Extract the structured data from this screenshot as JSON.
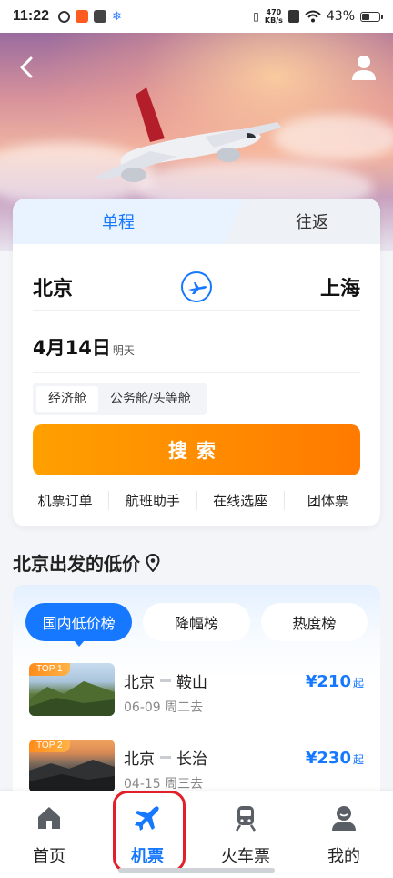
{
  "status_bar": {
    "time": "11:22",
    "net_speed_value": "470",
    "net_speed_unit": "KB/s",
    "battery": "43%"
  },
  "header": {
    "back_icon": "back-arrow-icon",
    "user_icon": "user-icon"
  },
  "trip_tabs": [
    {
      "label": "单程",
      "active": true
    },
    {
      "label": "往返",
      "active": false
    }
  ],
  "route": {
    "from": "北京",
    "to": "上海",
    "swap_icon": "plane-swap-icon"
  },
  "date": {
    "main": "4月14日",
    "sub": "明天"
  },
  "cabins": [
    {
      "label": "经济舱",
      "active": true
    },
    {
      "label": "公务舱/头等舱",
      "active": false
    }
  ],
  "search_button": "搜索",
  "quick_links": [
    "机票订单",
    "航班助手",
    "在线选座",
    "团体票"
  ],
  "low_price": {
    "title": "北京出发的低价",
    "tabs": [
      {
        "label": "国内低价榜",
        "active": true
      },
      {
        "label": "降幅榜",
        "active": false
      },
      {
        "label": "热度榜",
        "active": false
      }
    ],
    "routes": [
      {
        "rank": "TOP 1",
        "from": "北京",
        "to": "鞍山",
        "date": "06-09 周二去",
        "price": "¥210",
        "suffix": "起"
      },
      {
        "rank": "TOP 2",
        "from": "北京",
        "to": "长治",
        "date": "04-15 周三去",
        "price": "¥230",
        "suffix": "起"
      }
    ]
  },
  "bottom_nav": [
    {
      "label": "首页",
      "icon": "home-icon",
      "active": false
    },
    {
      "label": "机票",
      "icon": "airplane-icon",
      "active": true
    },
    {
      "label": "火车票",
      "icon": "train-icon",
      "active": false
    },
    {
      "label": "我的",
      "icon": "profile-icon",
      "active": false
    }
  ],
  "colors": {
    "accent": "#1677ff",
    "search_button": "#ff8a00",
    "highlight_box": "#e0202b"
  }
}
